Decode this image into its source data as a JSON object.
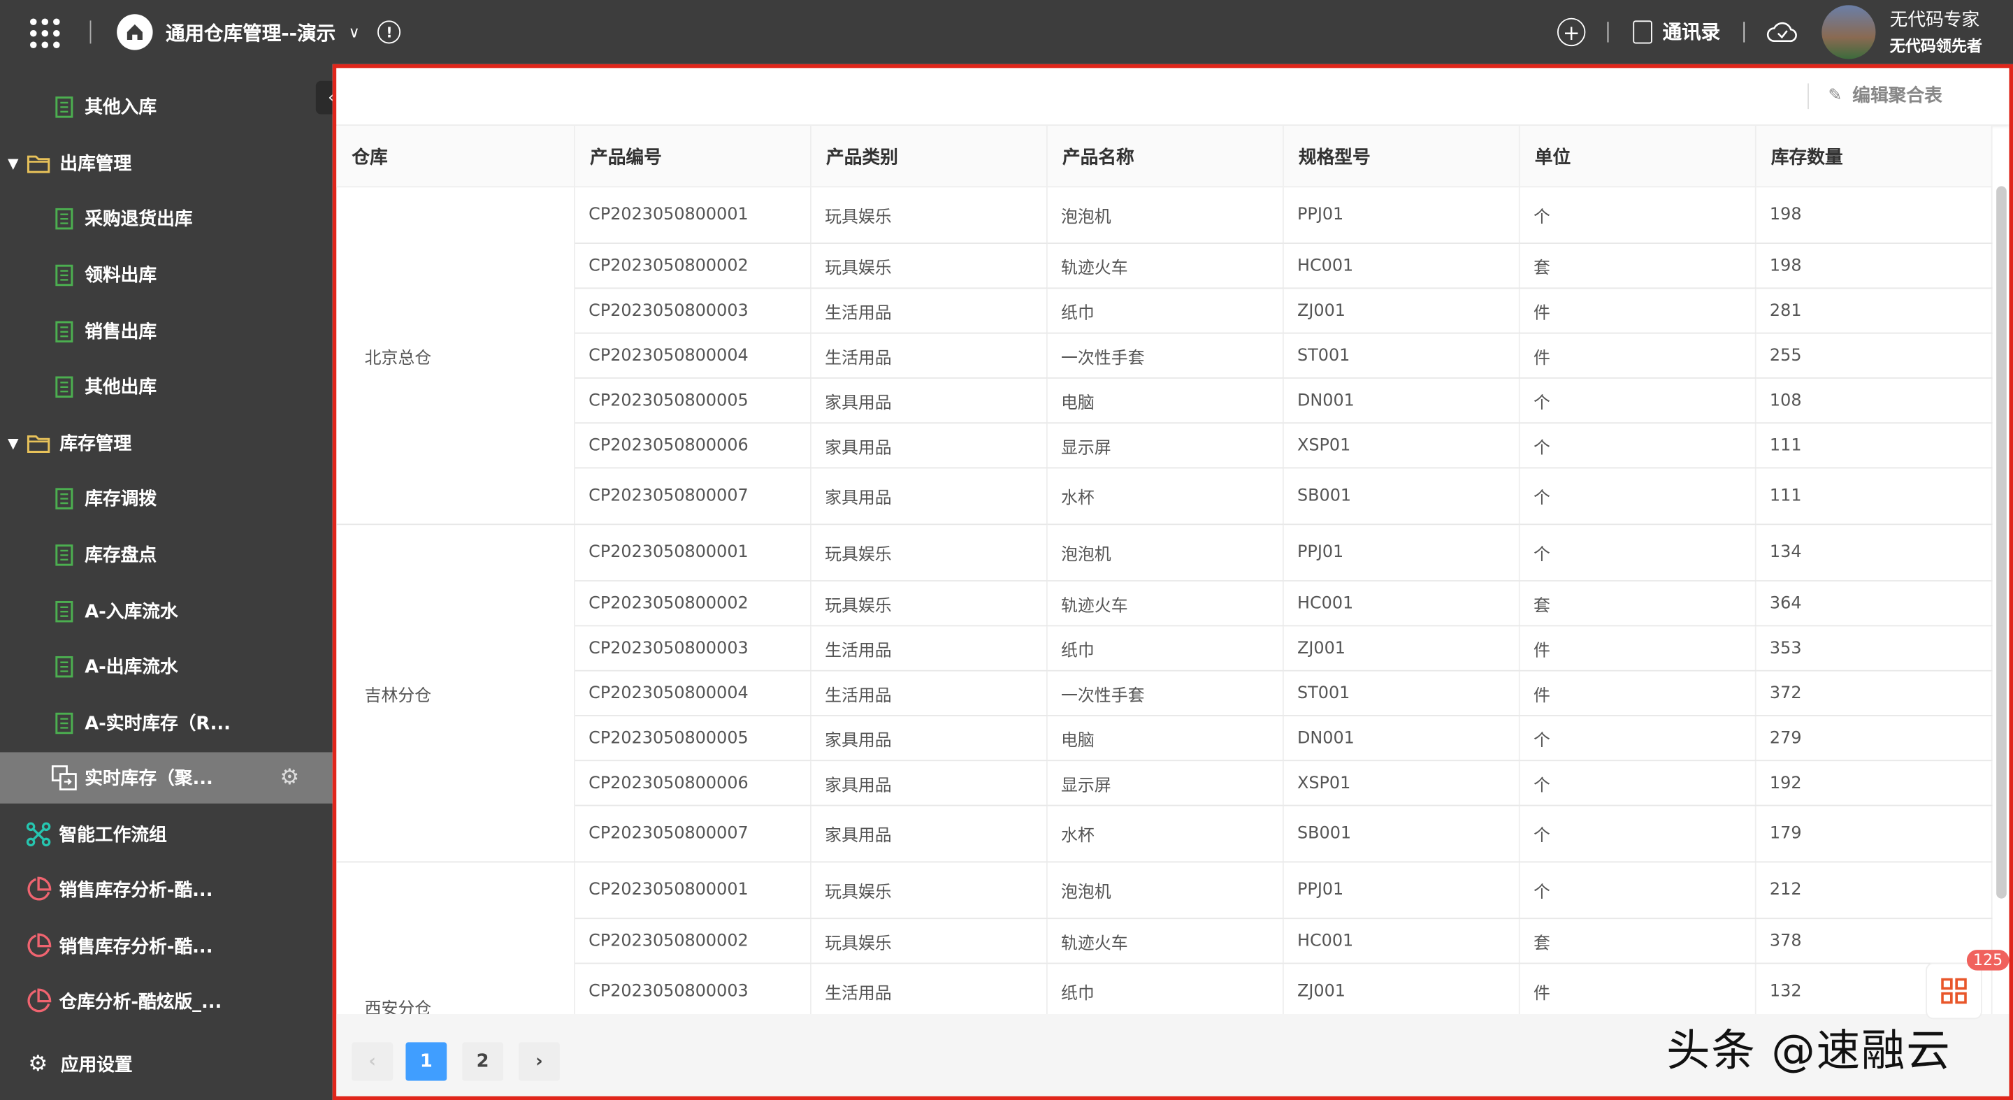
{
  "header": {
    "app_title": "通用仓库管理--演示",
    "contacts_label": "通讯录",
    "user_name": "无代码专家",
    "user_subtitle": "无代码领先者"
  },
  "sidebar": {
    "items": [
      {
        "label": "其他入库",
        "icon": "form-icon",
        "level": 2
      },
      {
        "label": "出库管理",
        "icon": "folder-icon",
        "level": 1
      },
      {
        "label": "采购退货出库",
        "icon": "form-icon",
        "level": 2
      },
      {
        "label": "领料出库",
        "icon": "form-icon",
        "level": 2
      },
      {
        "label": "销售出库",
        "icon": "form-icon",
        "level": 2
      },
      {
        "label": "其他出库",
        "icon": "form-icon",
        "level": 2
      },
      {
        "label": "库存管理",
        "icon": "folder-icon",
        "level": 1
      },
      {
        "label": "库存调拨",
        "icon": "form-icon",
        "level": 2
      },
      {
        "label": "库存盘点",
        "icon": "form-icon",
        "level": 2
      },
      {
        "label": "A-入库流水",
        "icon": "form-icon",
        "level": 2
      },
      {
        "label": "A-出库流水",
        "icon": "form-icon",
        "level": 2
      },
      {
        "label": "A-实时库存（R...",
        "icon": "form-icon",
        "level": 2
      },
      {
        "label": "实时库存（聚...",
        "icon": "aggregate-icon",
        "level": 2,
        "active": true
      },
      {
        "label": "智能工作流组",
        "icon": "workflow-icon",
        "level": 0
      },
      {
        "label": "销售库存分析-酷...",
        "icon": "chart-icon",
        "level": 0
      },
      {
        "label": "销售库存分析-酷...",
        "icon": "chart-icon",
        "level": 0
      },
      {
        "label": "仓库分析-酷炫版_...",
        "icon": "chart-icon",
        "level": 0
      }
    ],
    "settings_label": "应用设置"
  },
  "toolbar": {
    "edit_label": "编辑聚合表"
  },
  "table": {
    "columns": [
      "仓库",
      "产品编号",
      "产品类别",
      "产品名称",
      "规格型号",
      "单位",
      "库存数量"
    ],
    "groups": [
      {
        "warehouse": "北京总仓",
        "rows": [
          [
            "CP2023050800001",
            "玩具娱乐",
            "泡泡机",
            "PPJ01",
            "个",
            "198"
          ],
          [
            "CP2023050800002",
            "玩具娱乐",
            "轨迹火车",
            "HC001",
            "套",
            "198"
          ],
          [
            "CP2023050800003",
            "生活用品",
            "纸巾",
            "ZJ001",
            "件",
            "281"
          ],
          [
            "CP2023050800004",
            "生活用品",
            "一次性手套",
            "ST001",
            "件",
            "255"
          ],
          [
            "CP2023050800005",
            "家具用品",
            "电脑",
            "DN001",
            "个",
            "108"
          ],
          [
            "CP2023050800006",
            "家具用品",
            "显示屏",
            "XSP01",
            "个",
            "111"
          ],
          [
            "CP2023050800007",
            "家具用品",
            "水杯",
            "SB001",
            "个",
            "111"
          ]
        ]
      },
      {
        "warehouse": "吉林分仓",
        "rows": [
          [
            "CP2023050800001",
            "玩具娱乐",
            "泡泡机",
            "PPJ01",
            "个",
            "134"
          ],
          [
            "CP2023050800002",
            "玩具娱乐",
            "轨迹火车",
            "HC001",
            "套",
            "364"
          ],
          [
            "CP2023050800003",
            "生活用品",
            "纸巾",
            "ZJ001",
            "件",
            "353"
          ],
          [
            "CP2023050800004",
            "生活用品",
            "一次性手套",
            "ST001",
            "件",
            "372"
          ],
          [
            "CP2023050800005",
            "家具用品",
            "电脑",
            "DN001",
            "个",
            "279"
          ],
          [
            "CP2023050800006",
            "家具用品",
            "显示屏",
            "XSP01",
            "个",
            "192"
          ],
          [
            "CP2023050800007",
            "家具用品",
            "水杯",
            "SB001",
            "个",
            "179"
          ]
        ]
      },
      {
        "warehouse": "西安分仓",
        "rows": [
          [
            "CP2023050800001",
            "玩具娱乐",
            "泡泡机",
            "PPJ01",
            "个",
            "212"
          ],
          [
            "CP2023050800002",
            "玩具娱乐",
            "轨迹火车",
            "HC001",
            "套",
            "378"
          ],
          [
            "CP2023050800003",
            "生活用品",
            "纸巾",
            "ZJ001",
            "件",
            "132"
          ]
        ]
      }
    ]
  },
  "pagination": {
    "pages": [
      "1",
      "2"
    ],
    "current": "1"
  },
  "badge": {
    "count": "125"
  },
  "watermark": "头条 @速融云",
  "colors": {
    "accent": "#409eff",
    "highlight_border": "#e0261b",
    "badge": "#f0625d"
  }
}
